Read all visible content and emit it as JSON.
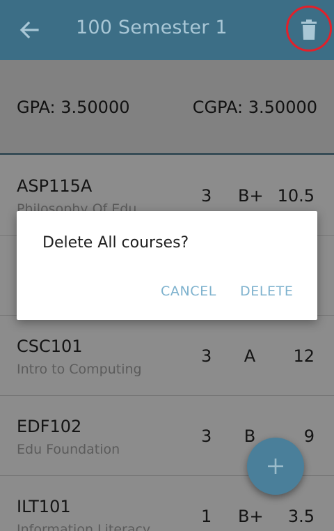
{
  "appbar": {
    "title": "100 Semester 1",
    "back_icon": "arrow-left-icon",
    "delete_icon": "trash-icon"
  },
  "summary": {
    "gpa": "GPA: 3.50000",
    "cgpa": "CGPA: 3.50000"
  },
  "courses": [
    {
      "code": "ASP115A",
      "name": "Philosophy Of Edu",
      "units": "3",
      "grade": "B+",
      "points": "10.5"
    },
    {
      "code": "",
      "name": "",
      "units": "",
      "grade": "",
      "points": ""
    },
    {
      "code": "CSC101",
      "name": "Intro to Computing",
      "units": "3",
      "grade": "A",
      "points": "12"
    },
    {
      "code": "EDF102",
      "name": "Edu Foundation",
      "units": "3",
      "grade": "B",
      "points": "9"
    },
    {
      "code": "ILT101",
      "name": "Information Literacy",
      "units": "1",
      "grade": "B+",
      "points": "3.5"
    }
  ],
  "dialog": {
    "message": "Delete All courses?",
    "cancel": "CANCEL",
    "delete": "DELETE"
  },
  "fab": {
    "icon": "plus-icon"
  },
  "colors": {
    "appbar": "#3c6e86",
    "accent": "#7eb2ce",
    "highlight_ring": "#e2202a"
  }
}
